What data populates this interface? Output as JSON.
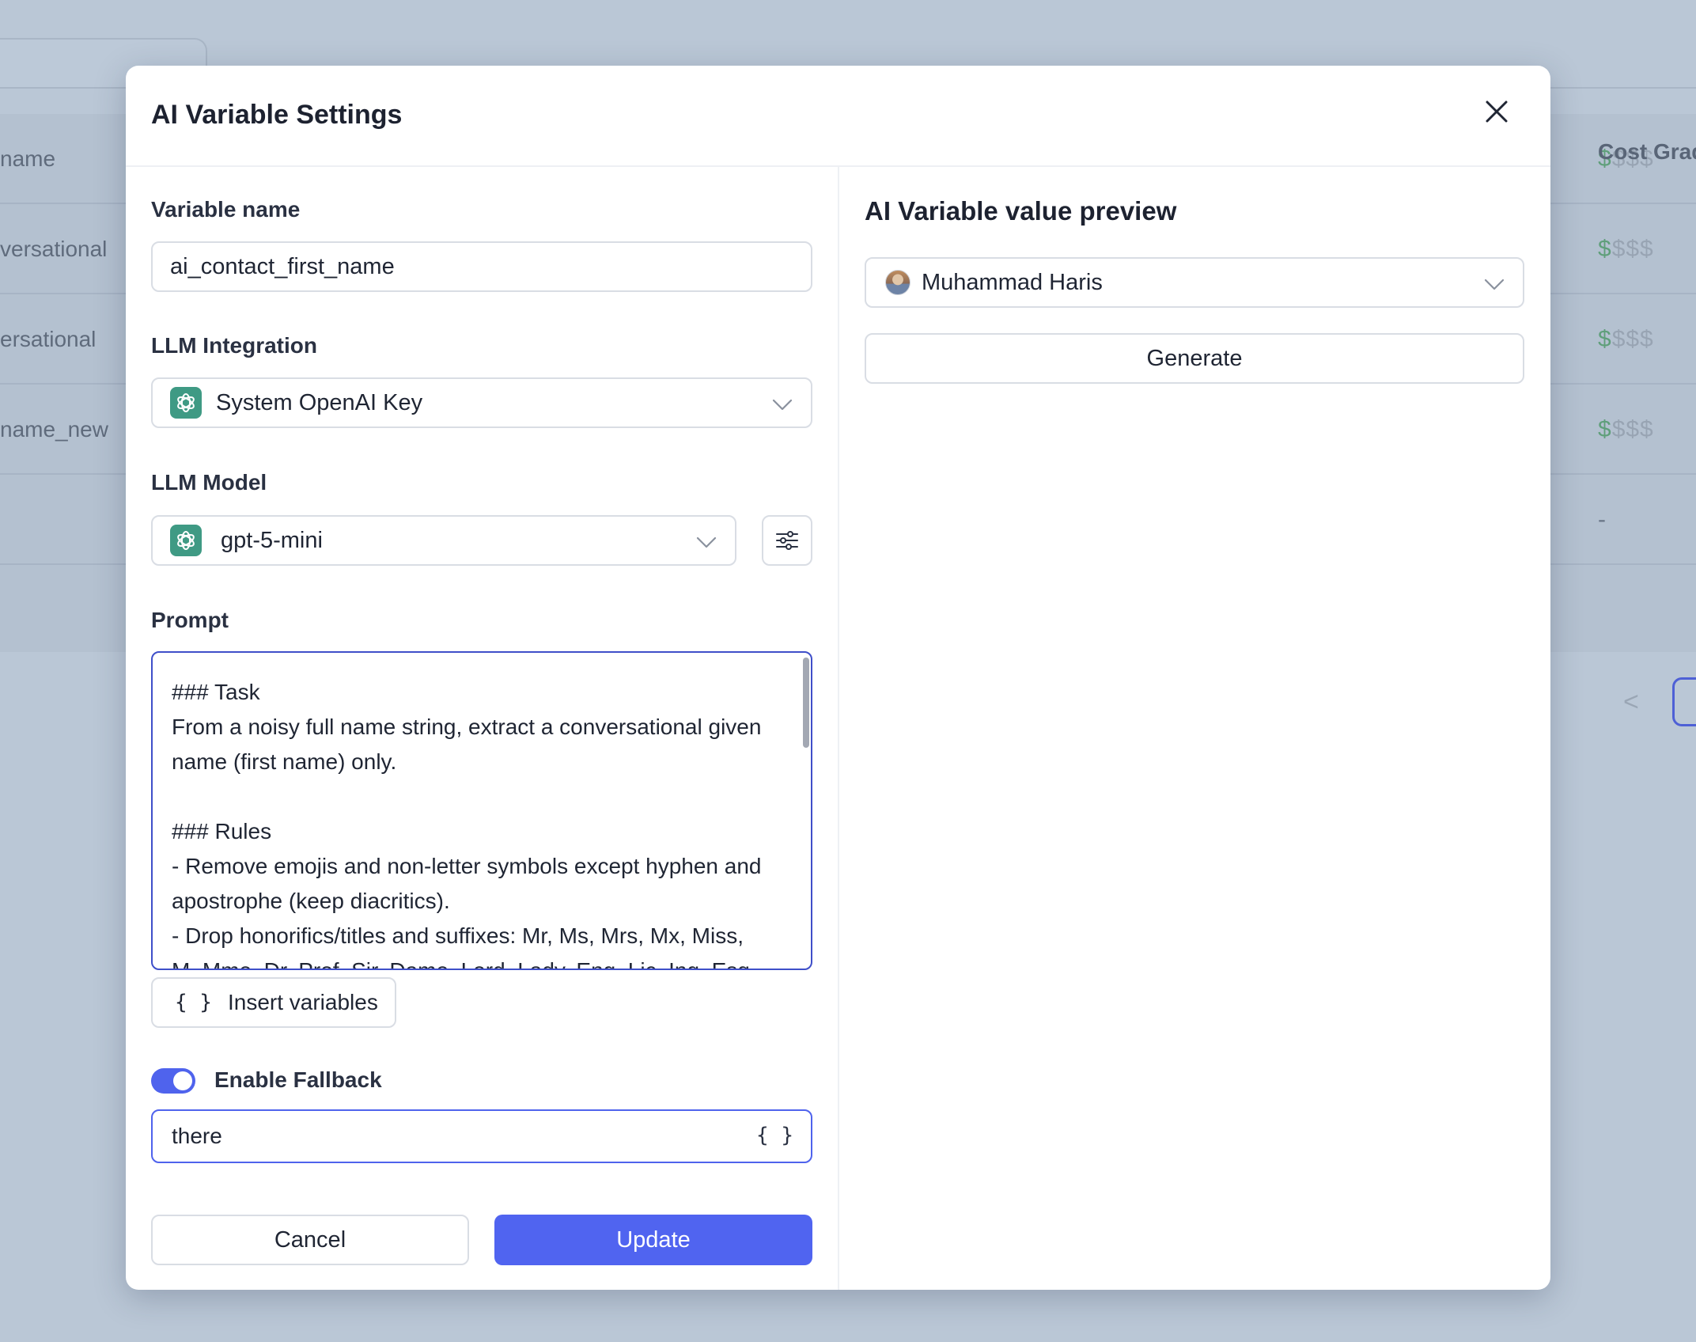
{
  "background": {
    "table_header_cost": "Cost Grad",
    "rows": [
      {
        "name": "name",
        "cost": "$$$$"
      },
      {
        "name": "versational",
        "cost": "$$$$"
      },
      {
        "name": "ersational",
        "cost": "$$$$"
      },
      {
        "name": "name_new",
        "cost": "$$$$"
      },
      {
        "name": "",
        "cost": "-"
      }
    ],
    "pager_prev": "<"
  },
  "modal": {
    "title": "AI Variable Settings",
    "variable_name": {
      "label": "Variable name",
      "value": "ai_contact_first_name"
    },
    "llm_integration": {
      "label": "LLM Integration",
      "value": "System OpenAI Key",
      "icon": "openai-icon"
    },
    "llm_model": {
      "label": "LLM Model",
      "value": "gpt-5-mini",
      "icon": "openai-icon",
      "settings_icon": "sliders-icon"
    },
    "prompt": {
      "label": "Prompt",
      "value": "### Task\nFrom a noisy full name string, extract a conversational given name (first name) only.\n\n### Rules\n- Remove emojis and non-letter symbols except hyphen and apostrophe (keep diacritics).\n- Drop honorifics/titles and suffixes: Mr, Ms, Mrs, Mx, Miss, M, Mme, Dr, Prof, Sir, Dame, Lord, Lady, Eng, Lic, Ing, Esq"
    },
    "insert_variables": {
      "braces": "{ }",
      "label": "Insert variables"
    },
    "fallback": {
      "toggle_label": "Enable Fallback",
      "enabled": true,
      "value": "there",
      "braces": "{ }"
    },
    "buttons": {
      "cancel": "Cancel",
      "update": "Update"
    },
    "preview": {
      "title": "AI Variable value preview",
      "contact": "Muhammad Haris",
      "generate": "Generate"
    }
  },
  "colors": {
    "accent": "#5064f0",
    "openai": "#3f9a84",
    "focus_border": "#3f4fc9"
  }
}
